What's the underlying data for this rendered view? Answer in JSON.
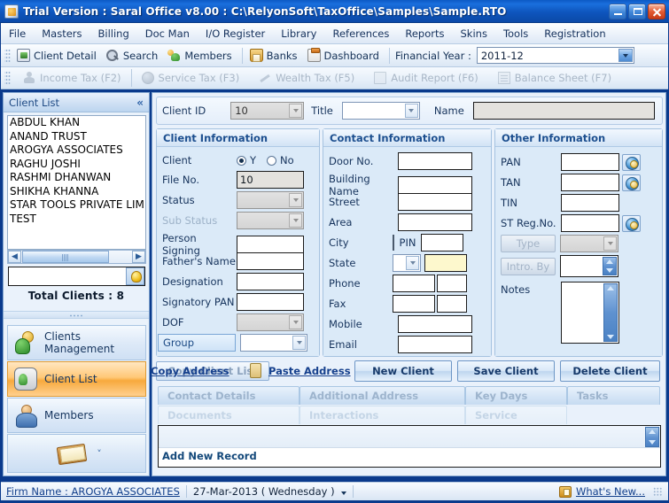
{
  "window": {
    "title": "Trial Version : Saral Office v8.00 : C:\\RelyonSoft\\TaxOffice\\Samples\\Sample.RTO",
    "app_icon": "app-icon",
    "minimize": "minimize-button",
    "maximize": "maximize-button",
    "close": "close-button"
  },
  "menu": {
    "items": [
      {
        "label": "File"
      },
      {
        "label": "Masters"
      },
      {
        "label": "Billing"
      },
      {
        "label": "Doc Man"
      },
      {
        "label": "I/O Register"
      },
      {
        "label": "Library"
      },
      {
        "label": "References"
      },
      {
        "label": "Reports"
      },
      {
        "label": "Skins"
      },
      {
        "label": "Tools"
      },
      {
        "label": "Registration"
      }
    ]
  },
  "toolbar": {
    "items": [
      {
        "label": "Client Detail",
        "icon": "client-detail-icon"
      },
      {
        "label": "Search",
        "icon": "search-icon"
      },
      {
        "label": "Members",
        "icon": "members-icon"
      },
      {
        "label": "Banks",
        "icon": "banks-icon"
      },
      {
        "label": "Dashboard",
        "icon": "dashboard-icon"
      }
    ],
    "financial_year_label": "Financial Year :",
    "financial_year_value": "2011-12"
  },
  "module_tabs": [
    {
      "label": "Income Tax (F2)",
      "icon": "income-tax-icon"
    },
    {
      "label": "Service Tax (F3)",
      "icon": "service-tax-icon"
    },
    {
      "label": "Wealth Tax (F5)",
      "icon": "wealth-tax-icon"
    },
    {
      "label": "Audit Report (F6)",
      "icon": "audit-report-icon"
    },
    {
      "label": "Balance Sheet (F7)",
      "icon": "balance-sheet-icon"
    }
  ],
  "client_list_panel": {
    "title": "Client List",
    "collapse_icon": "collapse-chevrons-icon",
    "clients": [
      "ABDUL KHAN",
      "ANAND TRUST",
      "AROGYA ASSOCIATES",
      "RAGHU JOSHI",
      "RASHMI DHANWAN",
      "SHIKHA KHANNA",
      "STAR TOOLS PRIVATE LIMI",
      "TEST"
    ],
    "scroll_left": "◀",
    "scroll_right": "▶",
    "search_value": "",
    "search_placeholder": "",
    "hint_icon": "lightbulb-icon",
    "total_clients": "Total Clients : 8"
  },
  "nav": {
    "items": [
      {
        "label": "Clients Management",
        "icon": "clients-management-icon",
        "active": false
      },
      {
        "label": "Client List",
        "icon": "client-list-icon",
        "active": true
      },
      {
        "label": "Members",
        "icon": "members-person-icon",
        "active": false
      }
    ],
    "more_icon": "notebook-icon",
    "more_chevron": "˅"
  },
  "form": {
    "client_id_label": "Client ID",
    "client_id_value": "10",
    "title_label": "Title",
    "title_value": "",
    "name_label": "Name",
    "name_value": "",
    "client_information": {
      "header": "Client Information",
      "client_label": "Client",
      "client_yes": "Y",
      "client_no": "No",
      "client_selected": "Y",
      "fields": [
        {
          "label": "File No.",
          "value": "10",
          "type": "text-gray"
        },
        {
          "label": "Status",
          "value": "",
          "type": "combo-disabled"
        },
        {
          "label": "Sub Status",
          "value": "",
          "type": "combo-disabled",
          "dim": true
        },
        {
          "label": "Person Signing",
          "value": "",
          "type": "text"
        },
        {
          "label": "Father's Name",
          "value": "",
          "type": "text"
        },
        {
          "label": "Designation",
          "value": "",
          "type": "text"
        },
        {
          "label": "Signatory PAN",
          "value": "",
          "type": "text"
        },
        {
          "label": "DOF",
          "value": "",
          "type": "combo-disabled"
        },
        {
          "label": "Group",
          "value": "",
          "type": "combo",
          "highlight": true
        }
      ]
    },
    "contact_information": {
      "header": "Contact Information",
      "fields": [
        {
          "label": "Door No.",
          "value": ""
        },
        {
          "label": "Building Name",
          "value": ""
        },
        {
          "label": "Street",
          "value": ""
        },
        {
          "label": "Area",
          "value": ""
        },
        {
          "label": "City",
          "value": "",
          "extra_label": "PIN",
          "extra_value": ""
        },
        {
          "label": "State",
          "value": "",
          "extra_value": ""
        },
        {
          "label": "Phone",
          "value": "",
          "extra_value": ""
        },
        {
          "label": "Fax",
          "value": "",
          "extra_value": ""
        },
        {
          "label": "Mobile",
          "value": ""
        },
        {
          "label": "Email",
          "value": ""
        }
      ]
    },
    "other_information": {
      "header": "Other Information",
      "fields": [
        {
          "label": "PAN",
          "value": "",
          "lookup": true
        },
        {
          "label": "TAN",
          "value": "",
          "lookup": true
        },
        {
          "label": "TIN",
          "value": "",
          "lookup": false
        },
        {
          "label": "ST Reg.No.",
          "value": "",
          "lookup": true
        }
      ],
      "type_button": "Type",
      "type_value": "",
      "intro_button": "Intro. By",
      "intro_value": "",
      "notes_label": "Notes",
      "notes_value": ""
    }
  },
  "actions": {
    "copy_address": "Copy Address",
    "overlap_button": "Copy Client List",
    "clipboard_icon": "clipboard-icon",
    "paste_address": "Paste Address",
    "new_client": "New Client",
    "save_client": "Save Client",
    "delete_client": "Delete Client"
  },
  "detail_tabs": {
    "row1": [
      {
        "label": "Contact Details",
        "accel": "C"
      },
      {
        "label": "Additional Address",
        "accel": "A"
      },
      {
        "label": "Key Days",
        "accel": "y"
      },
      {
        "label": "Tasks",
        "accel": "k"
      }
    ],
    "row2": [
      {
        "label": "Documents",
        "accel": "D"
      },
      {
        "label": "Interactions",
        "accel": "I"
      },
      {
        "label": "Service",
        "accel": "v"
      }
    ]
  },
  "record_area": {
    "add_new_record": "Add New Record",
    "scroll_up": "▲",
    "scroll_down": "▼"
  },
  "statusbar": {
    "firm_name": "Firm Name : AROGYA ASSOCIATES",
    "date": "27-Mar-2013 ( Wednesday )",
    "whats_new": "What's New...",
    "whats_new_icon": "whats-new-icon",
    "resize_grip": "resize-grip-icon"
  },
  "colors": {
    "title_blue": "#0e55bd",
    "panel_blue": "#dbeaf8",
    "accent_orange": "#f7a93c",
    "link_blue": "#13408c",
    "header_text": "#1d4f8f"
  }
}
